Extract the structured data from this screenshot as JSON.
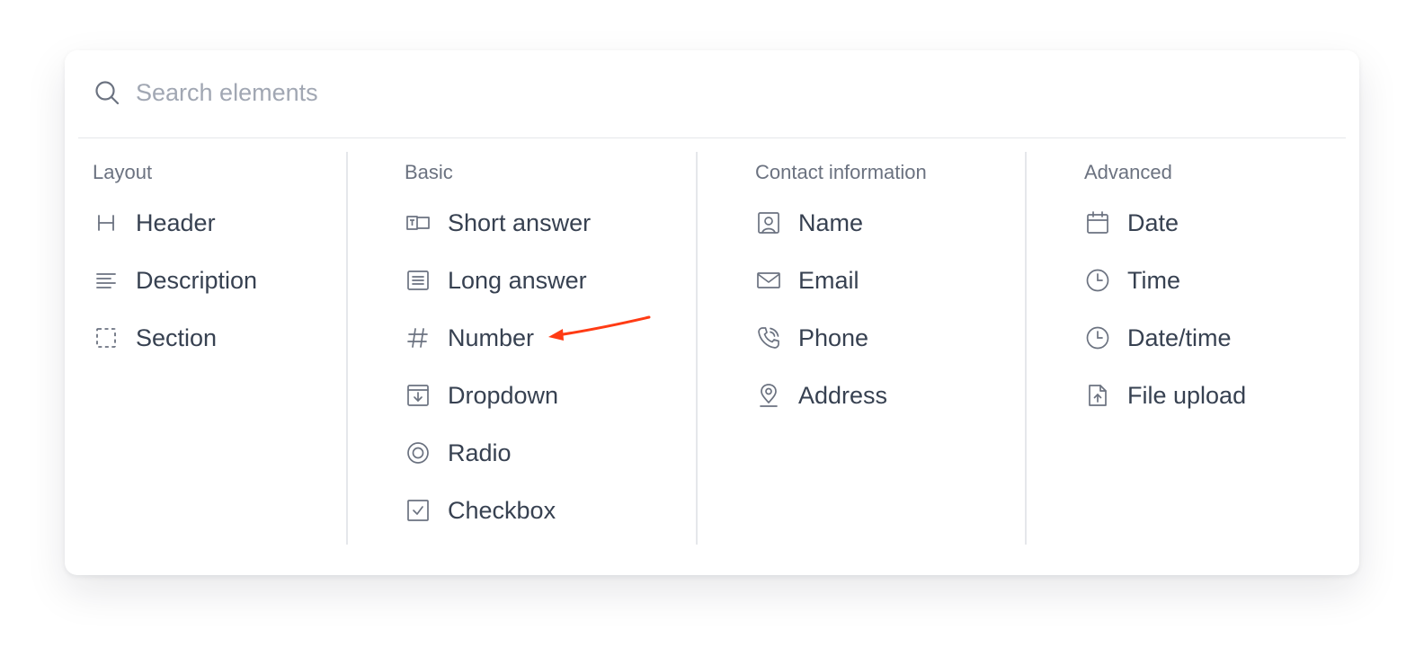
{
  "search": {
    "placeholder": "Search elements",
    "icon": "search-icon"
  },
  "columns": [
    {
      "title": "Layout",
      "items": [
        {
          "label": "Header",
          "icon": "heading-icon"
        },
        {
          "label": "Description",
          "icon": "text-lines-icon"
        },
        {
          "label": "Section",
          "icon": "dashed-square-icon"
        }
      ]
    },
    {
      "title": "Basic",
      "items": [
        {
          "label": "Short answer",
          "icon": "text-input-icon"
        },
        {
          "label": "Long answer",
          "icon": "textarea-icon"
        },
        {
          "label": "Number",
          "icon": "hash-icon"
        },
        {
          "label": "Dropdown",
          "icon": "dropdown-box-icon"
        },
        {
          "label": "Radio",
          "icon": "radio-icon"
        },
        {
          "label": "Checkbox",
          "icon": "checkbox-icon"
        }
      ]
    },
    {
      "title": "Contact information",
      "items": [
        {
          "label": "Name",
          "icon": "user-portrait-icon"
        },
        {
          "label": "Email",
          "icon": "envelope-icon"
        },
        {
          "label": "Phone",
          "icon": "phone-icon"
        },
        {
          "label": "Address",
          "icon": "map-pin-icon"
        }
      ]
    },
    {
      "title": "Advanced",
      "items": [
        {
          "label": "Date",
          "icon": "calendar-icon"
        },
        {
          "label": "Time",
          "icon": "clock-icon"
        },
        {
          "label": "Date/time",
          "icon": "clock-icon"
        },
        {
          "label": "File upload",
          "icon": "file-upload-icon"
        }
      ]
    }
  ],
  "annotation": {
    "target": "Number",
    "color": "#ff3b14"
  },
  "colors": {
    "text": "#374151",
    "muted": "#6b7280",
    "placeholder": "#a1a7b3",
    "icon": "#6b7280",
    "divider": "#e5e7eb"
  }
}
